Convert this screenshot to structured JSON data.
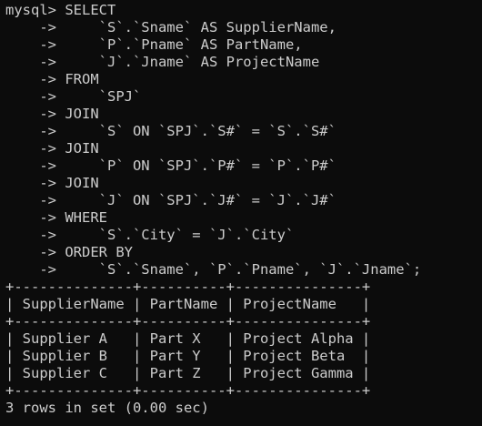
{
  "terminal": {
    "foreground": "#cccccc",
    "background": "#0c0c0c",
    "lines": [
      "mysql> SELECT",
      "    ->     `S`.`Sname` AS SupplierName,",
      "    ->     `P`.`Pname` AS PartName,",
      "    ->     `J`.`Jname` AS ProjectName",
      "    -> FROM",
      "    ->     `SPJ`",
      "    -> JOIN",
      "    ->     `S` ON `SPJ`.`S#` = `S`.`S#`",
      "    -> JOIN",
      "    ->     `P` ON `SPJ`.`P#` = `P`.`P#`",
      "    -> JOIN",
      "    ->     `J` ON `SPJ`.`J#` = `J`.`J#`",
      "    -> WHERE",
      "    ->     `S`.`City` = `J`.`City`",
      "    -> ORDER BY",
      "    ->     `S`.`Sname`, `P`.`Pname`, `J`.`Jname`;",
      "+--------------+----------+---------------+",
      "| SupplierName | PartName | ProjectName   |",
      "+--------------+----------+---------------+",
      "| Supplier A   | Part X   | Project Alpha |",
      "| Supplier B   | Part Y   | Project Beta  |",
      "| Supplier C   | Part Z   | Project Gamma |",
      "+--------------+----------+---------------+",
      "3 rows in set (0.00 sec)"
    ]
  }
}
